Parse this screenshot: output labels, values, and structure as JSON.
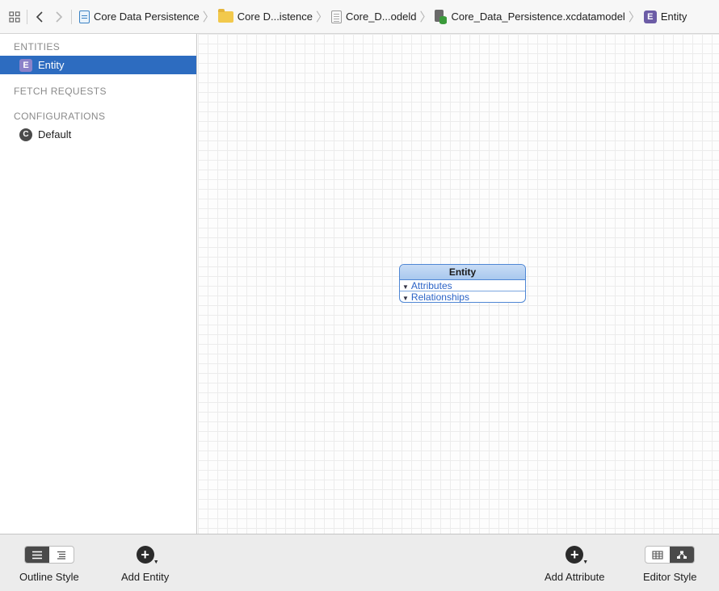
{
  "jumpbar": {
    "grid_icon": "grid-icon",
    "back_icon": "chevron-left-icon",
    "forward_icon": "chevron-right-icon",
    "crumbs": [
      {
        "label": "Core Data Persistence",
        "icon": "project-icon"
      },
      {
        "label": "Core D...istence",
        "icon": "folder-icon"
      },
      {
        "label": "Core_D...odeld",
        "icon": "xcdatamodeld-icon"
      },
      {
        "label": "Core_Data_Persistence.xcdatamodel",
        "icon": "data-model-icon"
      },
      {
        "label": "Entity",
        "icon": "entity-icon"
      }
    ]
  },
  "sidebar": {
    "entities_header": "ENTITIES",
    "entity_item": {
      "badge": "E",
      "label": "Entity"
    },
    "fetch_requests_header": "FETCH REQUESTS",
    "configurations_header": "CONFIGURATIONS",
    "configuration_item": {
      "badge": "C",
      "label": "Default"
    }
  },
  "canvas": {
    "entity": {
      "title": "Entity",
      "attributes_label": "Attributes",
      "relationships_label": "Relationships"
    }
  },
  "toolbar": {
    "outline_style_label": "Outline Style",
    "add_entity_label": "Add Entity",
    "add_attribute_label": "Add Attribute",
    "editor_style_label": "Editor Style"
  },
  "colors": {
    "selection": "#2d6cc0",
    "entity_badge": "#6c5ca6",
    "entity_border": "#4f87d4",
    "link_text": "#2b63c6"
  }
}
